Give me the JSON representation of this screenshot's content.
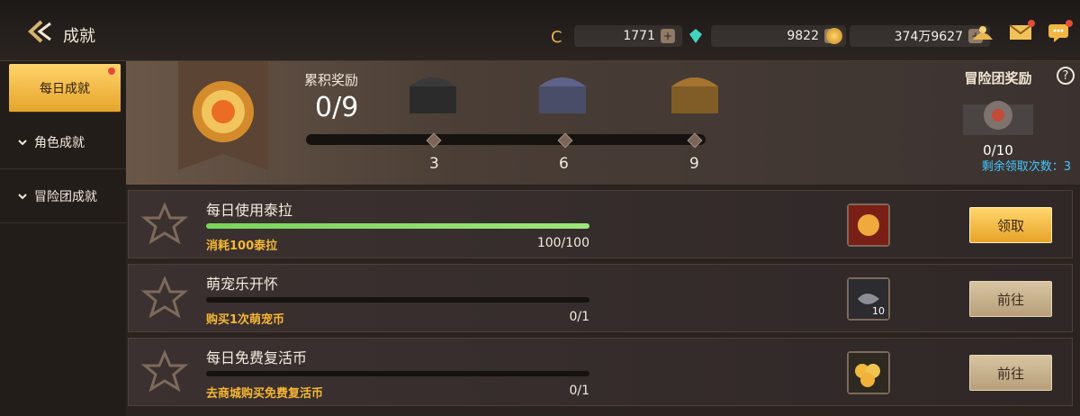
{
  "header": {
    "title": "成就",
    "currencies": [
      {
        "value": "1771",
        "icon": "c-icon"
      },
      {
        "value": "9822",
        "icon": "gem-icon"
      },
      {
        "value": "374万9627",
        "icon": "coin-icon"
      }
    ],
    "icons": [
      "treasure-bag-icon",
      "mail-icon",
      "chat-icon"
    ]
  },
  "sidebar": {
    "items": [
      {
        "label": "每日成就",
        "active": true
      },
      {
        "label": "角色成就",
        "active": false
      },
      {
        "label": "冒险团成就",
        "active": false
      }
    ]
  },
  "rewards": {
    "label": "累积奖励",
    "value": "0/9",
    "milestones": [
      "3",
      "6",
      "9"
    ]
  },
  "adventure": {
    "title": "冒险团奖励",
    "count": "0/10",
    "remain": "剩余领取次数：3"
  },
  "tasks": [
    {
      "name": "每日使用泰拉",
      "desc": "消耗100泰拉",
      "progress": "100/100",
      "fraction": 1.0,
      "reward_count": "",
      "button": "领取",
      "button_style": "gold"
    },
    {
      "name": "萌宠乐开怀",
      "desc": "购买1次萌宠币",
      "progress": "0/1",
      "fraction": 0.0,
      "reward_count": "10",
      "button": "前往",
      "button_style": "tan"
    },
    {
      "name": "每日免费复活币",
      "desc": "去商城购买免费复活币",
      "progress": "0/1",
      "fraction": 0.0,
      "reward_count": "",
      "button": "前往",
      "button_style": "tan"
    }
  ],
  "colors": {
    "accent_gold": "#f6b734",
    "progress_green": "#79d45b",
    "info_blue": "#43c6ff"
  }
}
